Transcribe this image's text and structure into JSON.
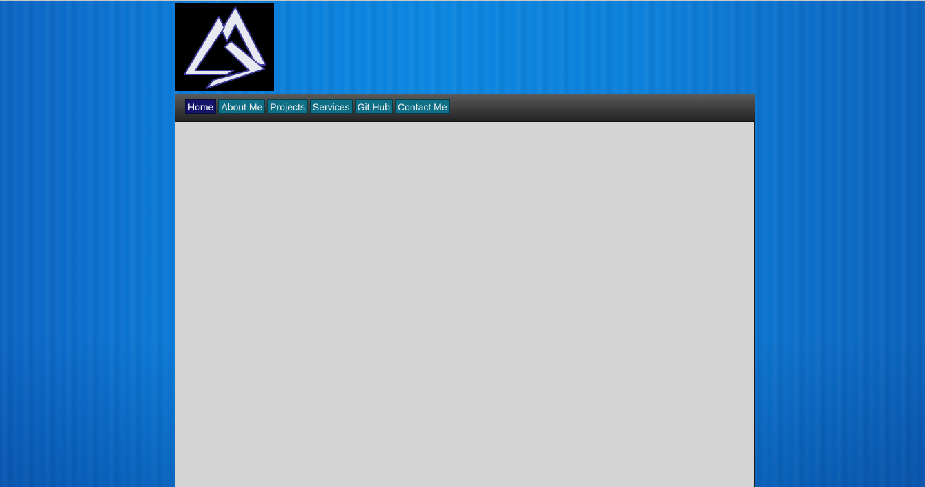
{
  "nav": {
    "items": [
      {
        "label": "Home",
        "active": true
      },
      {
        "label": "About Me",
        "active": false
      },
      {
        "label": "Projects",
        "active": false
      },
      {
        "label": "Services",
        "active": false
      },
      {
        "label": "Git Hub",
        "active": false
      },
      {
        "label": "Contact Me",
        "active": false
      }
    ]
  },
  "logo": {
    "icon": "triangle-knot-logo-icon"
  },
  "colors": {
    "background_blue": "#0a7fd9",
    "nav_button": "#0f6f86",
    "nav_button_active": "#14146a",
    "content_bg": "#d4d4d4"
  }
}
